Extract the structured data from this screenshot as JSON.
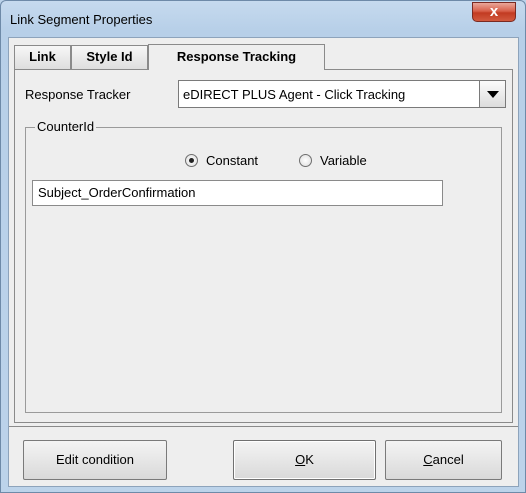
{
  "window": {
    "title": "Link Segment Properties",
    "close_label": "x"
  },
  "tabs": [
    {
      "label": "Link"
    },
    {
      "label": "Style Id"
    },
    {
      "label": "Response Tracking"
    }
  ],
  "response_tracker": {
    "label": "Response Tracker",
    "selected": "eDIRECT PLUS Agent - Click Tracking"
  },
  "counter": {
    "legend": "CounterId",
    "mode_constant": "Constant",
    "mode_variable": "Variable",
    "selected_mode": "Constant",
    "value": "Subject_OrderConfirmation"
  },
  "buttons": {
    "edit_condition": "Edit condition",
    "ok_mnemonic": "O",
    "ok_rest": "K",
    "cancel_mnemonic": "C",
    "cancel_rest": "ancel"
  }
}
